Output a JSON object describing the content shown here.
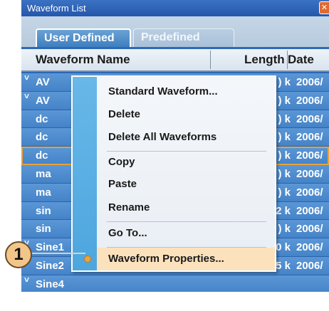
{
  "window": {
    "title": "Waveform List",
    "close_glyph": "✕"
  },
  "tabs": [
    {
      "label": "User Defined",
      "selected": true
    },
    {
      "label": "Predefined",
      "selected": false
    }
  ],
  "table": {
    "columns": [
      "Waveform Name",
      "Length",
      "Date"
    ],
    "rows": [
      {
        "chevron": "˅",
        "name": "AV",
        "length": ") k",
        "date": "2006/"
      },
      {
        "chevron": "˅",
        "name": "AV",
        "length": ") k",
        "date": "2006/"
      },
      {
        "chevron": "",
        "name": "dc",
        "length": ") k",
        "date": "2006/"
      },
      {
        "chevron": "",
        "name": "dc",
        "length": ") k",
        "date": "2006/"
      },
      {
        "chevron": "",
        "name": "dc",
        "length": ") k",
        "date": "2006/"
      },
      {
        "chevron": "",
        "name": "ma",
        "length": ") k",
        "date": "2006/"
      },
      {
        "chevron": "",
        "name": "ma",
        "length": ") k",
        "date": "2006/"
      },
      {
        "chevron": "",
        "name": "sin",
        "length": "2 k",
        "date": "2006/"
      },
      {
        "chevron": "",
        "name": "sin",
        "length": ") k",
        "date": "2006/"
      },
      {
        "chevron": "˅",
        "name": "Sine1",
        "length": "1.00 k",
        "date": "2006/"
      },
      {
        "chevron": "˅",
        "name": "Sine2",
        "length": "2.45 k",
        "date": "2006/"
      },
      {
        "chevron": "˅",
        "name": "Sine4",
        "length": "",
        "date": ""
      }
    ]
  },
  "context_menu": {
    "items": [
      "Standard Waveform...",
      "Delete",
      "Delete All Waveforms",
      "Copy",
      "Paste",
      "Rename",
      "Go To...",
      "Waveform Properties..."
    ],
    "highlighted": "Waveform Properties..."
  },
  "callout": {
    "label": "1"
  },
  "colors": {
    "row_blue": "#4583c8",
    "highlight": "#fbe2bd",
    "callout": "#f2c68a"
  }
}
